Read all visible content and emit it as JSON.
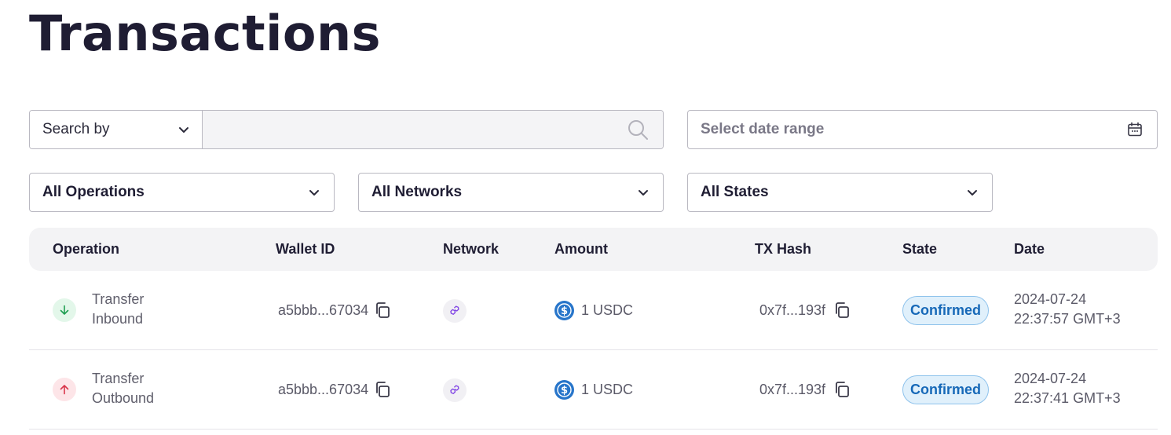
{
  "page": {
    "title": "Transactions"
  },
  "filters": {
    "search_by_label": "Search by",
    "search_value": "",
    "date_range_placeholder": "Select date range",
    "operations_selected": "All Operations",
    "networks_selected": "All Networks",
    "states_selected": "All States"
  },
  "table": {
    "columns": [
      "Operation",
      "Wallet ID",
      "Network",
      "Amount",
      "TX Hash",
      "State",
      "Date"
    ],
    "rows": [
      {
        "direction": "inbound",
        "operation_line1": "Transfer",
        "operation_line2": "Inbound",
        "wallet_id": "a5bbb...67034",
        "network_icon": "polygon-icon",
        "amount": "1 USDC",
        "tx_hash": "0x7f...193f",
        "state": "Confirmed",
        "date_line1": "2024-07-24",
        "date_line2": "22:37:57 GMT+3"
      },
      {
        "direction": "outbound",
        "operation_line1": "Transfer",
        "operation_line2": "Outbound",
        "wallet_id": "a5bbb...67034",
        "network_icon": "polygon-icon",
        "amount": "1 USDC",
        "tx_hash": "0x7f...193f",
        "state": "Confirmed",
        "date_line1": "2024-07-24",
        "date_line2": "22:37:41 GMT+3"
      }
    ]
  },
  "colors": {
    "title": "#1f1d33",
    "inbound_arrow": "#1f9e52",
    "outbound_arrow": "#d9364b",
    "network": "#8247e5",
    "usdc": "#2775ca",
    "badge_text": "#1769b8",
    "badge_bg": "#e0f0fb"
  }
}
